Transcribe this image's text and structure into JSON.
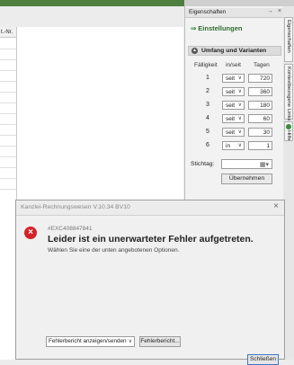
{
  "panel": {
    "title": "Eigenschaften",
    "title_controls": {
      "pin": "→",
      "close": "×"
    },
    "link": "Einstellungen",
    "section": "Umfang und Varianten",
    "columns": {
      "faelligkeit": "Fälligkeit",
      "in_seit": "in/seit",
      "tagen": "Tagen"
    },
    "rows": [
      {
        "n": "1",
        "mode": "seit",
        "days": "720"
      },
      {
        "n": "2",
        "mode": "seit",
        "days": "360"
      },
      {
        "n": "3",
        "mode": "seit",
        "days": "180"
      },
      {
        "n": "4",
        "mode": "seit",
        "days": "60"
      },
      {
        "n": "5",
        "mode": "seit",
        "days": "30"
      },
      {
        "n": "6",
        "mode": "in",
        "days": "1"
      }
    ],
    "stichtag_label": "Stichtag:",
    "apply_button": "Übernehmen"
  },
  "side_tabs": [
    "Eigenschaften",
    "Kontextbezogene Links",
    "Hilfe"
  ],
  "background": {
    "left_col_header": "t.-Nr."
  },
  "dialog": {
    "title": "Kanzlei-Rechnungswesen V.10.34 BV10",
    "error_id": "#EXC408847841",
    "heading": "Leider ist ein unerwarteter Fehler aufgetreten.",
    "subtext": "Wählen Sie eine der unten angebotenen Optionen.",
    "select_value": "Fehlerbericht anzeigen/senden",
    "report_button": "Fehlerbericht...",
    "close_button": "Schließen"
  },
  "colors": {
    "error_red": "#d2232a",
    "accent_green": "#2e6b2e",
    "primary_border": "#3b78c8"
  }
}
